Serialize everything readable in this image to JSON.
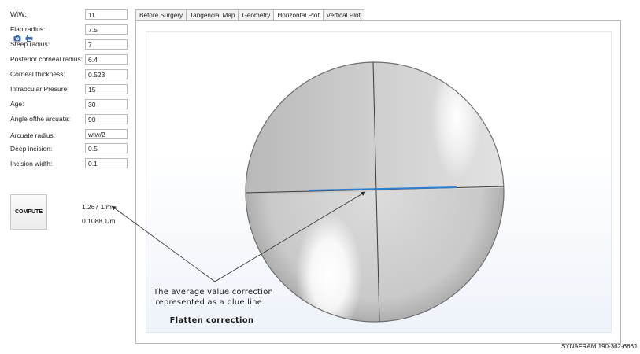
{
  "params": [
    {
      "label": "WtW:",
      "value": "11"
    },
    {
      "label": "Flap radius:",
      "value": "7.5"
    },
    {
      "label": "Steep radius:",
      "value": "7"
    },
    {
      "label": "Posterior corneal radius:",
      "value": "6.4"
    },
    {
      "label": "Corneal thickness:",
      "value": "0.523"
    },
    {
      "label": "Intraocular Presure:",
      "value": "15"
    },
    {
      "label": "Age:",
      "value": "30"
    },
    {
      "label": "Angle ofthe arcuate:",
      "value": "90"
    },
    {
      "label": "Arcuate radius:",
      "value": "wtw/2"
    },
    {
      "label": "Deep incision:",
      "value": "0.5"
    },
    {
      "label": "Incision width:",
      "value": "0.1"
    }
  ],
  "compute": {
    "label": "COMPUTE"
  },
  "results": {
    "primary": "1.267 1/m",
    "secondary": "0.1088 1/m"
  },
  "tabs": [
    {
      "label": "Before Surgery",
      "active": false
    },
    {
      "label": "Tangencial Map",
      "active": false
    },
    {
      "label": "Geometry",
      "active": false
    },
    {
      "label": "Horizontal Plot",
      "active": true
    },
    {
      "label": "Vertical Plot",
      "active": false
    }
  ],
  "toolbar": {
    "camera_icon": "camera-icon",
    "print_icon": "print-icon"
  },
  "annotation": {
    "line1": "The average value correction",
    "line2": "represented as a blue line.",
    "title": "Flatten correction"
  },
  "colors": {
    "correction_line": "#2f7fd1",
    "accent": "#3f6fb0"
  },
  "footer": {
    "text": "SYNAFRAM  190-362-666J"
  }
}
